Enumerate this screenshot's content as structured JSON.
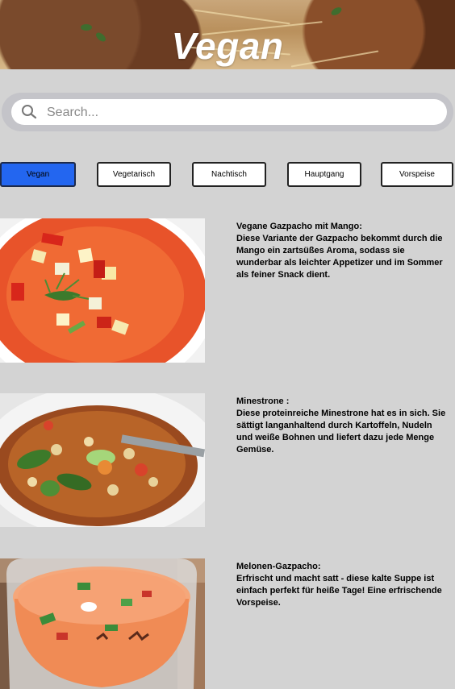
{
  "header": {
    "title": "Vegan"
  },
  "search": {
    "placeholder": "Search..."
  },
  "categories": [
    {
      "label": "Vegan",
      "active": true
    },
    {
      "label": "Vegetarisch",
      "active": false
    },
    {
      "label": "Nachtisch",
      "active": false
    },
    {
      "label": "Hauptgang",
      "active": false
    },
    {
      "label": "Vorspeise",
      "active": false
    }
  ],
  "recipes": [
    {
      "title": "Vegane Gazpacho mit Mango:",
      "description": "Diese Variante der Gazpacho bekommt durch die Mango ein zartsüßes Aroma, sodass sie wunderbar als leichter Appetizer und im Sommer als feiner Snack dient."
    },
    {
      "title": "Minestrone :",
      "description": "Diese proteinreiche Minestrone hat es in sich. Sie sättigt langanhaltend durch Kartoffeln, Nudeln und weiße Bohnen und liefert dazu jede Menge Gemüse."
    },
    {
      "title": "Melonen-Gazpacho:",
      "description": "Erfrischt und macht satt - diese kalte Suppe ist einfach perfekt für heiße Tage! Eine erfrischende Vorspeise."
    }
  ],
  "colors": {
    "background": "#d3d3d3",
    "active_button": "#2366f0",
    "search_frame": "#c4c4c9"
  }
}
